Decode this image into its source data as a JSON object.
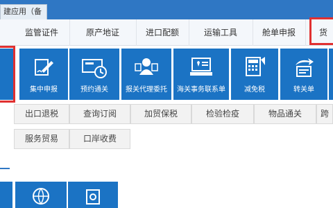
{
  "header": {
    "tab_label": "建应用（备用）"
  },
  "top_tabs": [
    {
      "label": "监管证件"
    },
    {
      "label": "原产地证"
    },
    {
      "label": "进口配额"
    },
    {
      "label": "运输工具"
    },
    {
      "label": "舱单申报"
    },
    {
      "label": "货"
    }
  ],
  "tiles": [
    {
      "label": "集中申报",
      "icon": "document-sign-icon"
    },
    {
      "label": "预约通关",
      "icon": "clock-card-icon"
    },
    {
      "label": "报关代理委托",
      "icon": "agent-delegation-icon"
    },
    {
      "label": "海关事务联系单",
      "icon": "computer-contact-icon"
    },
    {
      "label": "减免税",
      "icon": "calculator-icon"
    },
    {
      "label": "转关单",
      "icon": "transfer-document-icon"
    }
  ],
  "rows": {
    "row_a": [
      {
        "label": "出口退税"
      },
      {
        "label": "查询订阅"
      },
      {
        "label": "加贸保税"
      },
      {
        "label": "检验检疫"
      },
      {
        "label": "物品通关"
      },
      {
        "label": "跨"
      }
    ],
    "row_b": [
      {
        "label": "服务贸易"
      },
      {
        "label": "口岸收费"
      }
    ]
  },
  "colors": {
    "accent": "#2f77c4",
    "tile": "#1b73c4",
    "highlight": "#e03030"
  }
}
